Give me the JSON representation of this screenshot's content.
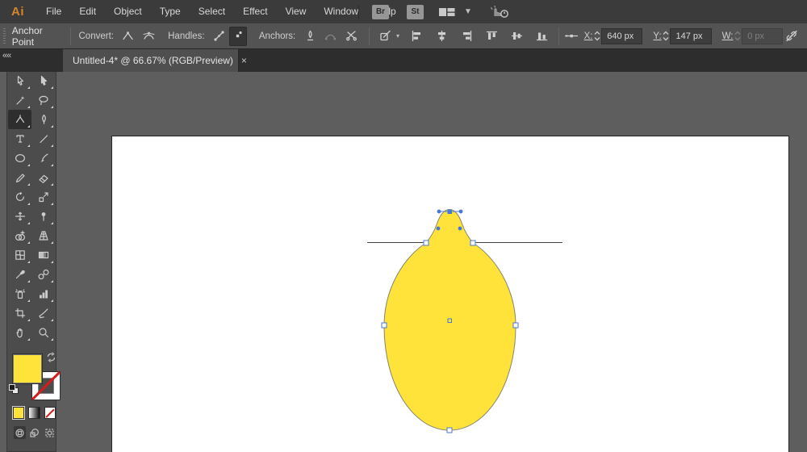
{
  "app": {
    "logo": "Ai"
  },
  "menubar": {
    "menus": [
      "File",
      "Edit",
      "Object",
      "Type",
      "Select",
      "Effect",
      "View",
      "Window",
      "Help"
    ],
    "bridge_label": "Br",
    "stock_label": "St"
  },
  "control_bar": {
    "mode_label": "Anchor Point",
    "convert_label": "Convert:",
    "handles_label": "Handles:",
    "anchors_label": "Anchors:",
    "x_label": "X:",
    "x_value": "640 px",
    "y_label": "Y:",
    "y_value": "147 px",
    "w_label": "W:",
    "w_value": "0 px"
  },
  "document_tab": {
    "title": "Untitled-4* @ 66.67% (RGB/Preview)",
    "close_glyph": "×",
    "collapse_glyph": "««"
  },
  "toolbar": {
    "tools": [
      {
        "id": "selection-tool"
      },
      {
        "id": "direct-selection-tool"
      },
      {
        "id": "magic-wand-tool"
      },
      {
        "id": "lasso-tool"
      },
      {
        "id": "anchor-point-tool",
        "active": true
      },
      {
        "id": "curvature-tool"
      },
      {
        "id": "type-tool"
      },
      {
        "id": "line-segment-tool"
      },
      {
        "id": "ellipse-tool"
      },
      {
        "id": "paintbrush-tool"
      },
      {
        "id": "pencil-tool"
      },
      {
        "id": "eraser-tool"
      },
      {
        "id": "rotate-tool"
      },
      {
        "id": "scale-tool"
      },
      {
        "id": "width-tool"
      },
      {
        "id": "puppet-warp-tool"
      },
      {
        "id": "shape-builder-tool"
      },
      {
        "id": "perspective-grid-tool"
      },
      {
        "id": "mesh-tool"
      },
      {
        "id": "gradient-tool"
      },
      {
        "id": "eyedropper-tool"
      },
      {
        "id": "blend-tool"
      },
      {
        "id": "symbol-sprayer-tool"
      },
      {
        "id": "column-graph-tool"
      },
      {
        "id": "artboard-tool"
      },
      {
        "id": "slice-tool"
      },
      {
        "id": "hand-tool"
      },
      {
        "id": "zoom-tool"
      }
    ]
  },
  "colors": {
    "shape_fill": "#ffe23a",
    "shape_stroke": "#85856d",
    "selection_blue": "#4679d7",
    "logo_orange": "#d6862c",
    "menubar_bg": "#3b3b3b",
    "controlbar_bg": "#535353",
    "tabstrip_bg": "#2d2d2d",
    "pasteboard_bg": "#5e5e5e",
    "artboard_bg": "#ffffff",
    "stroke_none_red": "#d61b1b"
  }
}
